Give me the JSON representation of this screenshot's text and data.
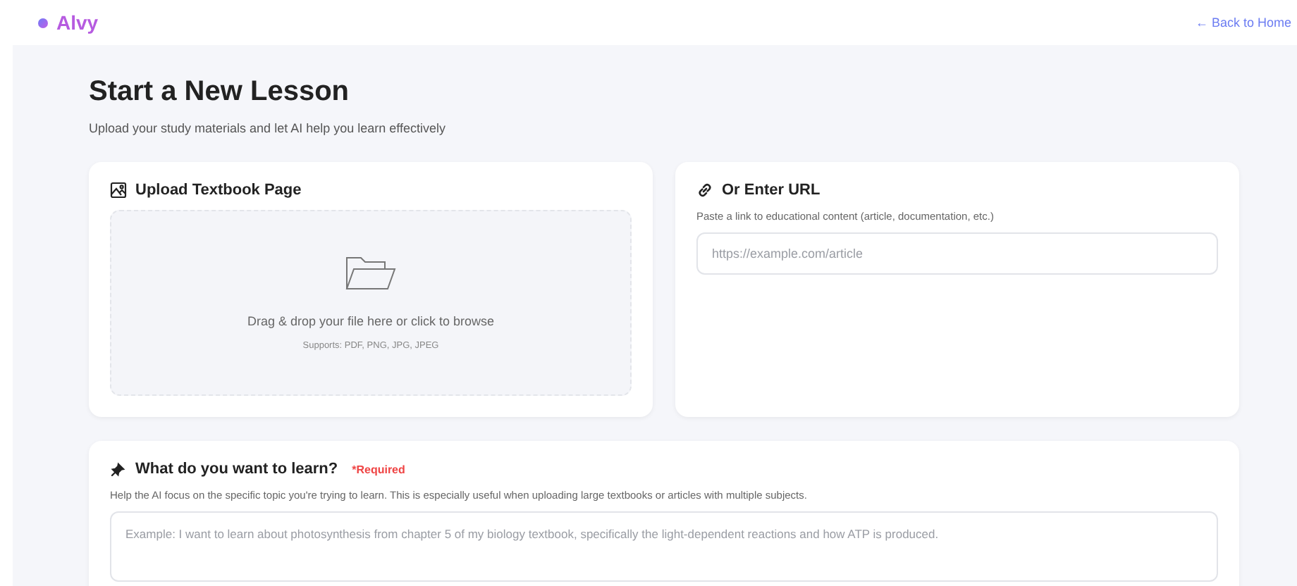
{
  "header": {
    "brand": "Alvy",
    "back_link": "← Back to Home"
  },
  "page": {
    "title": "Start a New Lesson",
    "subtitle": "Upload your study materials and let AI help you learn effectively"
  },
  "upload_card": {
    "title": "Upload Textbook Page",
    "drop_text": "Drag & drop your file here or click to browse",
    "formats": "Supports: PDF, PNG, JPG, JPEG"
  },
  "url_card": {
    "title": "Or Enter URL",
    "hint": "Paste a link to educational content (article, documentation, etc.)",
    "placeholder": "https://example.com/article"
  },
  "topic_card": {
    "title": "What do you want to learn?",
    "required": "*Required",
    "hint": "Help the AI focus on the specific topic you're trying to learn. This is especially useful when uploading large textbooks or articles with multiple subjects.",
    "placeholder": "Example: I want to learn about photosynthesis from chapter 5 of my biology textbook, specifically the light-dependent reactions and how ATP is produced."
  }
}
